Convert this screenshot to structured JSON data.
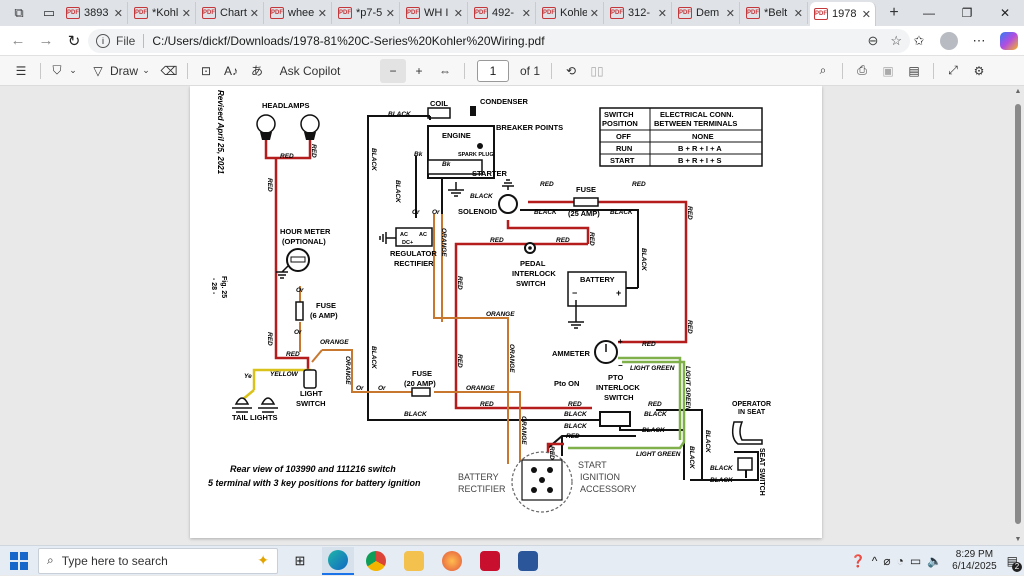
{
  "tabs": [
    {
      "label": "3893"
    },
    {
      "label": "*Kohl"
    },
    {
      "label": "Chart"
    },
    {
      "label": "whee"
    },
    {
      "label": "*p7-5"
    },
    {
      "label": "WH I"
    },
    {
      "label": "492-"
    },
    {
      "label": "Kohle"
    },
    {
      "label": "312-"
    },
    {
      "label": "Dem"
    },
    {
      "label": "*Belt"
    },
    {
      "label": "1978"
    }
  ],
  "address": {
    "scheme_label": "File",
    "url": "C:/Users/dickf/Downloads/1978-81%20C-Series%20Kohler%20Wiring.pdf"
  },
  "toolbar": {
    "draw_label": "Draw",
    "copilot_label": "Ask Copilot",
    "page_number": "1",
    "page_total": "of 1"
  },
  "diagram": {
    "revised": "Revised April 25, 2021",
    "fig": "Fig. 25",
    "page_num": "- 28 -",
    "headlamps": "HEADLAMPS",
    "coil": "COIL",
    "condenser": "CONDENSER",
    "engine": "ENGINE",
    "breaker_points": "BREAKER POINTS",
    "spark_plug": "SPARK PLUG",
    "starter": "STARTER",
    "solenoid": "SOLENOID",
    "fuse25": "FUSE",
    "fuse25_amp": "(25 AMP)",
    "hour_meter": "HOUR METER",
    "optional": "(OPTIONAL)",
    "regulator": "REGULATOR",
    "rectifier": "RECTIFIER",
    "pedal1": "PEDAL",
    "pedal2": "INTERLOCK",
    "pedal3": "SWITCH",
    "battery": "BATTERY",
    "fuse6": "FUSE",
    "fuse6_amp": "(6 AMP)",
    "ammeter": "AMMETER",
    "pto1": "PTO",
    "pto2": "INTERLOCK",
    "pto3": "SWITCH",
    "pto_on": "Pto ON",
    "operator1": "OPERATOR",
    "operator2": "IN SEAT",
    "seat_switch": "SEAT SWITCH",
    "tail_lights": "TAIL LIGHTS",
    "light1": "LIGHT",
    "light2": "SWITCH",
    "fuse20": "FUSE",
    "fuse20_amp": "(20 AMP)",
    "caption1": "Rear view of 103990 and 111216 switch",
    "caption2": "5 terminal with 3 key positions for battery ignition",
    "term_battery": "BATTERY",
    "term_rectifier": "RECTIFIER",
    "term_start": "START",
    "term_ignition": "IGNITION",
    "term_accessory": "ACCESSORY",
    "w_red": "RED",
    "w_black": "BLACK",
    "w_orange": "ORANGE",
    "w_yellow": "YELLOW",
    "w_lightgreen": "LIGHT GREEN",
    "w_or": "Or",
    "w_ye": "Ye",
    "w_bk": "Bk",
    "ac": "AC",
    "dc": "DC+",
    "plus": "+",
    "minus": "−",
    "table": {
      "h1a": "SWITCH",
      "h1b": "POSITION",
      "h2a": "ELECTRICAL CONN.",
      "h2b": "BETWEEN TERMINALS",
      "rows": [
        {
          "pos": "OFF",
          "conn": "NONE"
        },
        {
          "pos": "RUN",
          "conn": "B + R + I + A"
        },
        {
          "pos": "START",
          "conn": "B + R + I + S"
        }
      ]
    }
  },
  "taskbar": {
    "search_placeholder": "Type here to search",
    "time": "8:29 PM",
    "date": "6/14/2025",
    "notif_count": "2"
  },
  "colors": {
    "wire_red": "#b51c1c",
    "wire_black": "#111111",
    "wire_orange": "#c8782e",
    "wire_yellow": "#d9c21a",
    "wire_green": "#7fb04a"
  }
}
